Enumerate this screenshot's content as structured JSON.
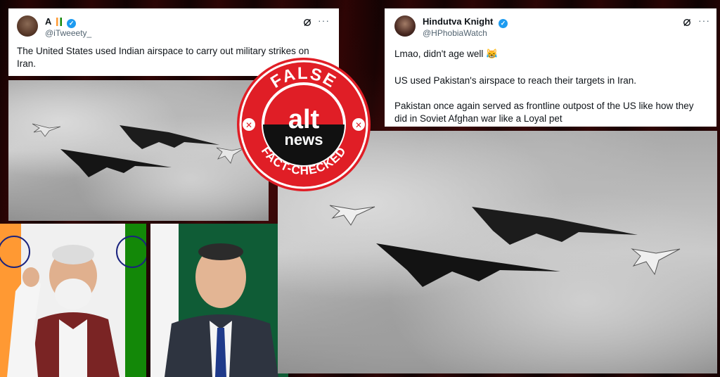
{
  "tweet_left": {
    "display_name": "A",
    "handle": "@iTweeety_",
    "text": "The United States used Indian airspace to carry out military strikes on Iran.",
    "verified_mark": "✓",
    "more_icon": "···"
  },
  "tweet_right": {
    "display_name": "Hindutva Knight",
    "handle": "@HPhobiaWatch",
    "line1": "Lmao, didn't age well 😹",
    "line2": "US used Pakistan's airspace to reach their targets in Iran.",
    "line3": "Pakistan once again served as frontline outpost of the US like how they did in Soviet Afghan war like a Loyal pet",
    "verified_mark": "✓",
    "more_icon": "···"
  },
  "stamp": {
    "top_word": "FALSE",
    "logo_main": "alt",
    "logo_sub": "news",
    "bottom_word": "FACT-CHECKED",
    "x_mark": "✕",
    "color": "#e01e26"
  },
  "icons": [
    "grok-icon",
    "more-icon",
    "verified-icon",
    "close-x-icon"
  ],
  "colors": {
    "stamp_red": "#e01e26",
    "verified_blue": "#1d9bf0",
    "background": "#1a0404"
  }
}
